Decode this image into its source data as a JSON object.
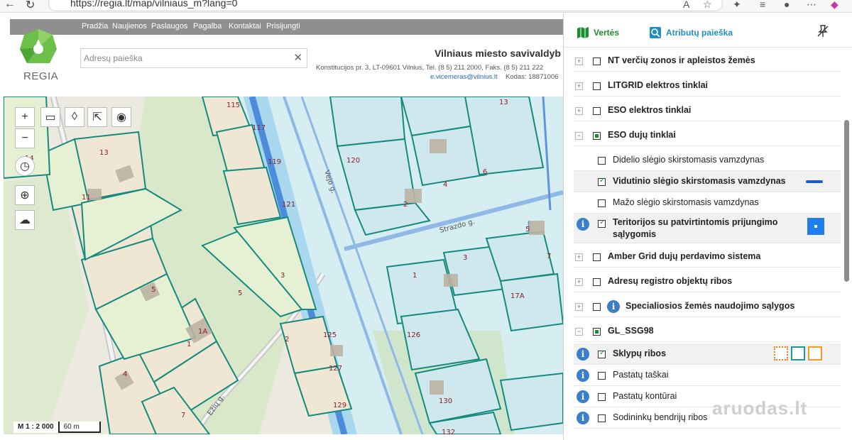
{
  "browser": {
    "url": "https://regia.lt/map/vilniaus_m?lang=0"
  },
  "header": {
    "nav": [
      "Pradžia",
      "Naujienos",
      "Paslaugos",
      "Pagalba",
      "Kontaktai",
      "Prisijungti"
    ],
    "logo_text": "REGIA",
    "search_placeholder": "Adresų paieška",
    "municipality_title": "Vilniaus miesto savivaldyb",
    "municipality_address": "Konstitucijos pr. 3, LT-09601 Vilnius, Tel. (8 5) 211 2000, Faks. (8 5) 211 222",
    "municipality_email": "e.vicemeras@vilnius.lt",
    "municipality_code": "Kodas: 18871006"
  },
  "map": {
    "scale_label": "M 1 : 2 000",
    "scale_length": "60 m",
    "street_labels": [
      "Vejo g.",
      "Strazdo g.",
      "Ežių g."
    ],
    "plot_numbers": [
      "115",
      "117",
      "119",
      "121",
      "13",
      "11",
      "14",
      "5",
      "3",
      "5",
      "1A",
      "1",
      "4",
      "7",
      "2",
      "125",
      "127",
      "129",
      "120",
      "2",
      "4",
      "6",
      "13",
      "1",
      "3",
      "5",
      "7",
      "17A",
      "126",
      "130",
      "132"
    ]
  },
  "panel": {
    "tabs": {
      "values": "Vertės",
      "attribute_search": "Atributų paieška"
    },
    "layers": [
      {
        "label": "NT verčių zonos ir apleistos žemės",
        "checked": false,
        "expander": "+",
        "bold": true
      },
      {
        "label": "LITGRID elektros tinklai",
        "checked": false,
        "expander": "+",
        "bold": true
      },
      {
        "label": "ESO elektros tinklai",
        "checked": false,
        "expander": "+",
        "bold": true
      },
      {
        "label": "ESO dujų tinklai",
        "checked": true,
        "expander": "−",
        "bold": true
      },
      {
        "label": "Didelio slėgio skirstomasis vamzdynas",
        "checked": false,
        "sub": true
      },
      {
        "label": "Vidutinio slėgio skirstomasis vamzdynas",
        "checked": true,
        "sub": true,
        "bold": true
      },
      {
        "label": "Mažo slėgio skirstomasis vamzdynas",
        "checked": false,
        "sub": true
      },
      {
        "label": "Teritorijos su patvirtintomis prijungimo",
        "label2": "sąlygomis",
        "checked": true,
        "sub": true,
        "bold": true,
        "info": true
      },
      {
        "label": "Amber Grid dujų perdavimo sistema",
        "checked": false,
        "expander": "+",
        "bold": true
      },
      {
        "label": "Adresų registro objektų ribos",
        "checked": false,
        "expander": "+",
        "bold": true
      },
      {
        "label": "Specialiosios žemės naudojimo sąlygos",
        "checked": false,
        "expander": "+",
        "bold": true,
        "info": true
      },
      {
        "label": "GL_SSG98",
        "checked": true,
        "expander": "−",
        "bold": true
      },
      {
        "label": "Sklypų ribos",
        "checked": true,
        "sub": true,
        "bold": true,
        "info": true
      },
      {
        "label": "Pastatų taškai",
        "checked": false,
        "sub": true,
        "info": true
      },
      {
        "label": "Pastatų kontūrai",
        "checked": false,
        "sub": true,
        "info": true
      },
      {
        "label": "Sodininkų bendrijų ribos",
        "checked": false,
        "sub": true,
        "info": true
      }
    ],
    "colors": {
      "medium_pressure_line": "#1560c8",
      "territory_symbol": "#1e7ef0",
      "plot_symbols": [
        "#f07d1e",
        "#1a9b9b",
        "#f59b28"
      ]
    }
  },
  "watermark": "aruodas.lt"
}
